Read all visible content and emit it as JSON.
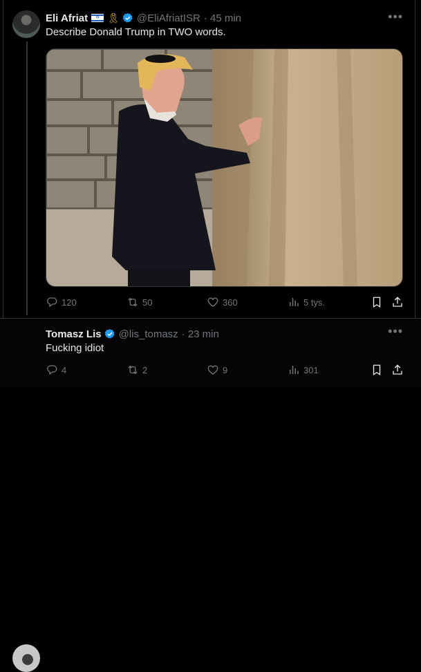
{
  "tweets": [
    {
      "author": "Eli Afriat",
      "handle": "@EliAfriatISR",
      "time": "· 45 min",
      "text": "Describe Donald Trump in TWO words.",
      "replies": "120",
      "reposts": "50",
      "likes": "360",
      "views": "5 tys.",
      "badges": [
        "israel-flag-icon",
        "yellow-ribbon-icon",
        "verified-badge-icon"
      ]
    },
    {
      "author": "Tomasz Lis",
      "handle": "@lis_tomasz",
      "time": "· 23 min",
      "text": "Fucking idiot",
      "replies": "4",
      "reposts": "2",
      "likes": "9",
      "views": "301",
      "badges": [
        "verified-badge-icon"
      ]
    }
  ],
  "colors": {
    "background": "#000000",
    "text": "#e7e9ea",
    "muted": "#71767b",
    "verified": "#1d9bf0",
    "border": "#2f3336"
  },
  "icons": [
    "more-icon",
    "reply-icon",
    "repost-icon",
    "like-icon",
    "views-icon",
    "bookmark-icon",
    "share-icon"
  ]
}
